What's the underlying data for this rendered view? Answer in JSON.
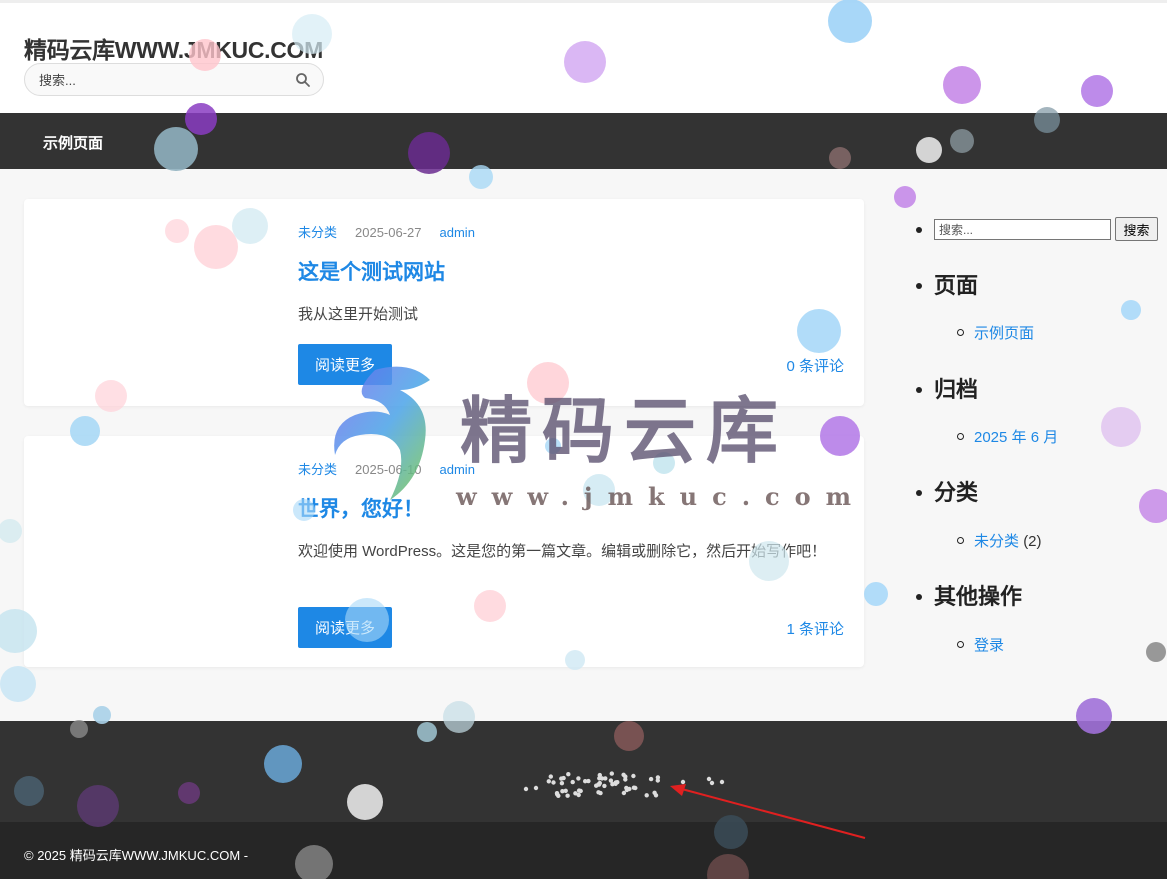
{
  "header": {
    "site_title": "精码云库WWW.JMKUC.COM",
    "search_placeholder": "搜索..."
  },
  "nav": {
    "items": [
      {
        "label": "示例页面"
      }
    ]
  },
  "posts": [
    {
      "category": "未分类",
      "date": "2025-06-27",
      "author": "admin",
      "title": "这是个测试网站",
      "excerpt": "我从这里开始测试",
      "read_more": "阅读更多",
      "comments": "0 条评论"
    },
    {
      "category": "未分类",
      "date": "2025-06-10",
      "author": "admin",
      "title": "世界，您好！",
      "excerpt": "欢迎使用 WordPress。这是您的第一篇文章。编辑或删除它，然后开始写作吧！",
      "read_more": "阅读更多",
      "comments": "1 条评论"
    }
  ],
  "sidebar": {
    "search_placeholder": "搜索...",
    "search_button": "搜索",
    "pages_heading": "页面",
    "pages": [
      "示例页面"
    ],
    "archives_heading": "归档",
    "archives": [
      "2025 年 6 月"
    ],
    "categories_heading": "分类",
    "categories": [
      {
        "name": "未分类",
        "count": "(2)"
      }
    ],
    "other_heading": "其他操作",
    "other": [
      "登录"
    ]
  },
  "footer": {
    "copyright": "© 2025 精码云库WWW.JMKUC.COM -"
  },
  "watermark": {
    "text": "精码云库",
    "url": "www.jmkuc.com"
  },
  "colors": {
    "accent": "#1e88e5",
    "nav_bg": "#333333",
    "footer_bg": "#262626"
  }
}
